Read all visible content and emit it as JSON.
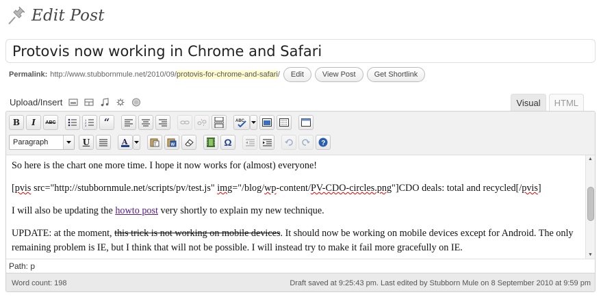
{
  "page": {
    "title": "Edit Post"
  },
  "post": {
    "title": "Protovis now working in Chrome and Safari"
  },
  "permalink": {
    "label": "Permalink:",
    "base": "http://www.stubbornmule.net/2010/09/",
    "slug": "protovis-for-chrome-and-safari",
    "trailing": "/",
    "buttons": {
      "edit": "Edit",
      "view": "View Post",
      "shortlink": "Get Shortlink"
    }
  },
  "media": {
    "label": "Upload/Insert",
    "icons": [
      "image-icon",
      "video-icon",
      "audio-icon",
      "media-icon",
      "gallery-icon"
    ]
  },
  "tabs": {
    "visual": "Visual",
    "html": "HTML"
  },
  "toolbar": {
    "row1": [
      "bold",
      "italic",
      "strikethrough",
      "bullet-list",
      "numbered-list",
      "blockquote",
      "align-left",
      "align-center",
      "align-right",
      "link",
      "unlink",
      "more",
      "spellcheck",
      "fullscreen",
      "kitchen-sink",
      "insert-custom"
    ],
    "format_select": "Paragraph",
    "row2": [
      "underline",
      "justify",
      "text-color",
      "paste-text",
      "paste-word",
      "remove-format",
      "embed-media",
      "special-char",
      "outdent",
      "indent",
      "undo",
      "redo",
      "help"
    ]
  },
  "content": {
    "p1": "So here is the chart one more time. I hope it now works for (almost) everyone!",
    "p2_a": "[",
    "p2_pvis": "pvis",
    "p2_b": " src=\"http://stubbornmule.net/scripts/pv/test.js\" ",
    "p2_img": "img",
    "p2_c": "=\"/blog/",
    "p2_wp": "wp",
    "p2_d": "-content/",
    "p2_png": "PV-CDO-circles.png",
    "p2_e": "\"]CDO deals: total and recycled[/",
    "p2_pvis2": "pvis",
    "p2_f": "]",
    "p3_a": "I will also be updating the ",
    "p3_link": "howto post",
    "p3_b": " very shortly to explain my new technique.",
    "p4_a": "UPDATE: at the moment, ",
    "p4_strike": "this trick is not working on mobile devices",
    "p4_b": ". It should now be working on mobile devices except for Android. The only remaining problem is IE, but I think that will not be possible. I will instead try to make it fail more gracefully on IE."
  },
  "path": "Path: p",
  "status": {
    "word_count": "Word count: 198",
    "saved": "Draft saved at 9:25:43 pm. Last edited by Stubborn Mule on 8 September 2010 at 9:59 pm"
  }
}
